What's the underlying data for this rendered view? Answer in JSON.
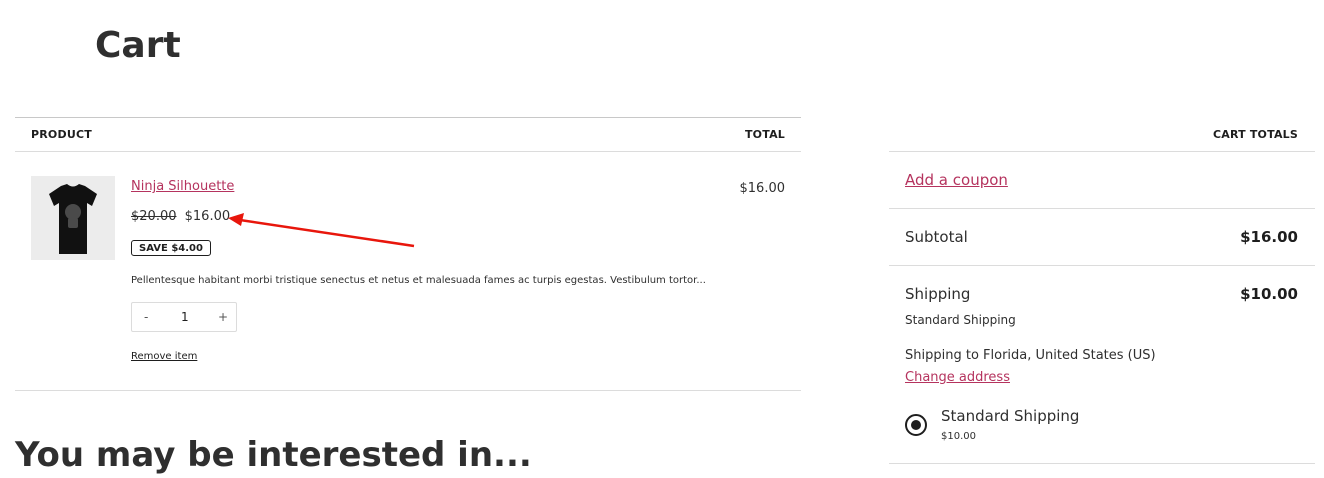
{
  "page": {
    "title": "Cart"
  },
  "cart_table": {
    "header_product": "PRODUCT",
    "header_total": "TOTAL",
    "items": [
      {
        "name": "Ninja Silhouette",
        "regular_price": "$20.00",
        "sale_price": "$16.00",
        "save_badge": "SAVE $4.00",
        "description": "Pellentesque habitant morbi tristique senectus et netus et malesuada fames ac turpis egestas. Vestibulum tortor...",
        "quantity": "1",
        "qty_minus": "-",
        "qty_plus": "+",
        "remove_label": "Remove item",
        "line_total": "$16.00",
        "image_icon": "tshirt-icon"
      }
    ]
  },
  "cart_totals": {
    "heading": "CART TOTALS",
    "coupon_label": "Add a coupon",
    "subtotal_label": "Subtotal",
    "subtotal_value": "$16.00",
    "shipping_label": "Shipping",
    "shipping_value": "$10.00",
    "shipping_method": "Standard Shipping",
    "shipping_destination": "Shipping to Florida, United States (US)",
    "change_address_label": "Change address",
    "shipping_options": [
      {
        "label": "Standard Shipping",
        "price": "$10.00",
        "selected": true
      }
    ]
  },
  "cross_sells": {
    "heading": "You may be interested in..."
  },
  "annotation": {
    "arrow_color": "#e8160c"
  },
  "colors": {
    "link": "#b5335e",
    "border": "#dcdcdc",
    "text": "#1e1e1e"
  }
}
